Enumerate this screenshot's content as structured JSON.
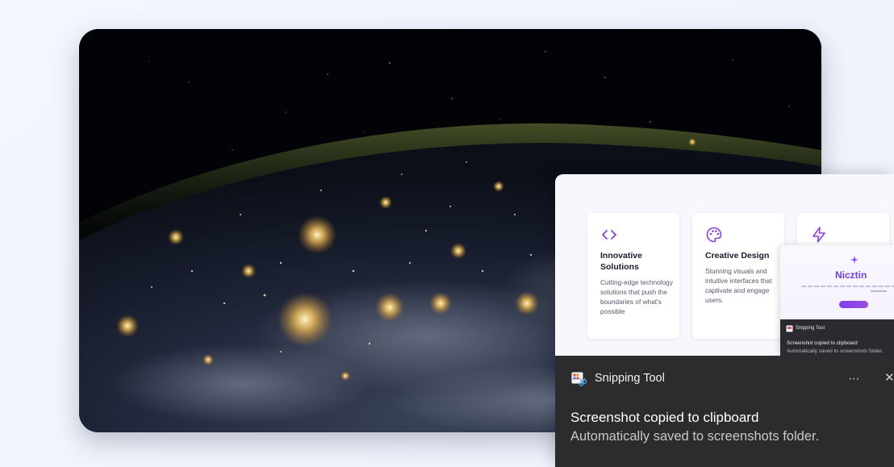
{
  "background_image": {
    "description_icon": "earth-at-night-image"
  },
  "preview": {
    "features": [
      {
        "icon": "code-icon",
        "title": "Innovative Solutions",
        "description": "Cutting-edge technology solutions that push the boundaries of what's possible"
      },
      {
        "icon": "palette-icon",
        "title": "Creative Design",
        "description": "Stunning visuals and intuitive interfaces that captivate and engage users."
      },
      {
        "icon": "lightning-icon",
        "title": "",
        "description": ""
      }
    ],
    "mini": {
      "brand": "Nicztin",
      "toast_app": "Snipping Tool",
      "toast_title": "Screenshot copied to clipboard",
      "toast_subtitle": "Automatically saved to screenshots folder."
    }
  },
  "notification": {
    "app_name": "Snipping Tool",
    "more_label": "⋯",
    "close_label": "✕",
    "title": "Screenshot copied to clipboard",
    "subtitle": "Automatically saved to screenshots folder."
  },
  "colors": {
    "accent": "#7c3aed",
    "toast_bg": "#2c2c2e"
  }
}
